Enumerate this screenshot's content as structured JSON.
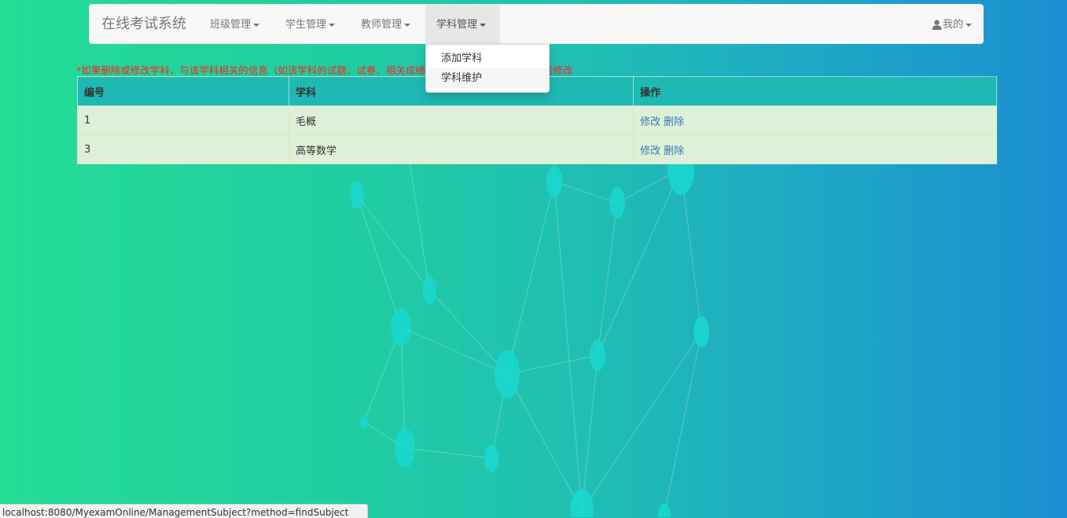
{
  "navbar": {
    "brand": "在线考试系统",
    "menus": [
      {
        "label": "班级管理"
      },
      {
        "label": "学生管理"
      },
      {
        "label": "教师管理"
      },
      {
        "label": "学科管理"
      }
    ],
    "user_label": "我的"
  },
  "dropdown": {
    "items": [
      {
        "label": "添加学科"
      },
      {
        "label": "学科维护"
      }
    ]
  },
  "warning": "*如果删除或修改学科，与该学科相关的信息（如该学科的试题、试卷、相关成绩等）也会进行相应的删除或者修改",
  "table": {
    "headers": [
      "编号",
      "学科",
      "操作"
    ],
    "rows": [
      {
        "id": "1",
        "subject": "毛概",
        "edit": "修改",
        "delete": "删除"
      },
      {
        "id": "3",
        "subject": "高等数学",
        "edit": "修改",
        "delete": "删除"
      }
    ]
  },
  "status_url": "localhost:8080/MyexamOnline/ManagementSubject?method=findSubject",
  "icons": {
    "user": "user-icon",
    "caret": "caret-down-icon"
  },
  "colors": {
    "warning": "#ff2020",
    "link": "#337ab7",
    "row_bg": "#dff0d8",
    "header_bg": "#1eb9b2"
  }
}
